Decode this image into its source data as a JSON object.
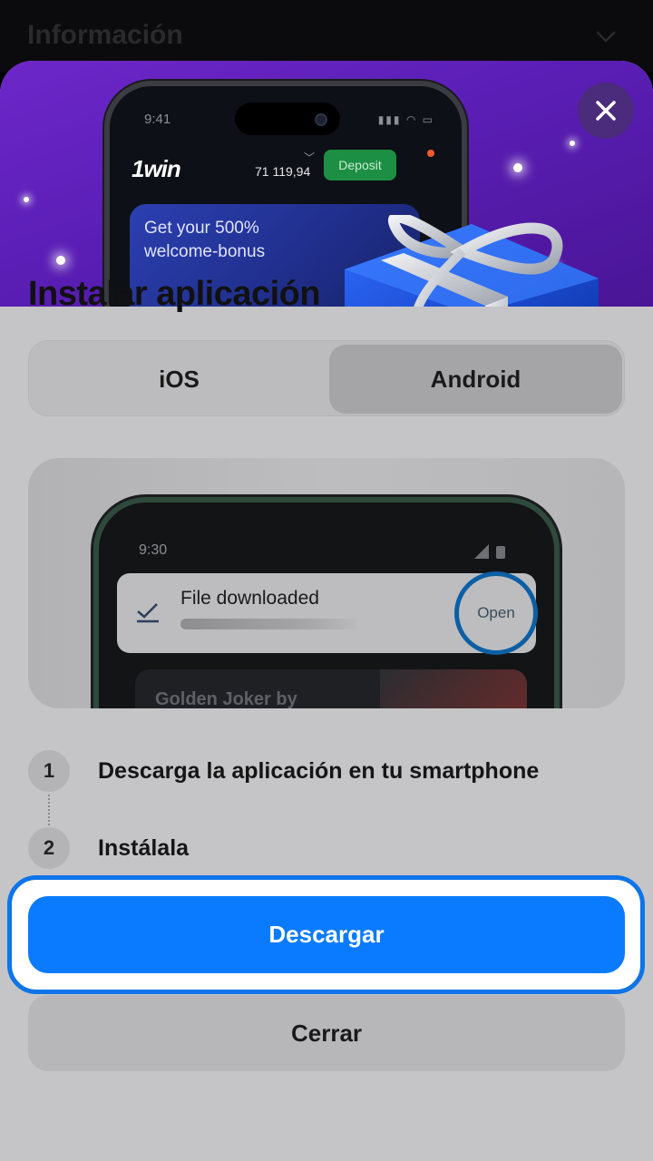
{
  "background_page": {
    "title": "Información"
  },
  "hero": {
    "phone_time": "9:41",
    "brand_logo": "1win",
    "balance": "71 119,94",
    "deposit_label": "Deposit",
    "banner_line1": "Get your 500%",
    "banner_line2": "welcome-bonus"
  },
  "modal": {
    "title": "Instalar aplicación",
    "tabs": [
      {
        "label": "iOS",
        "selected": false
      },
      {
        "label": "Android",
        "selected": true
      }
    ],
    "preview": {
      "phone_time": "9:30",
      "notification_title": "File downloaded",
      "notification_action": "Open",
      "game_title": "Golden Joker by"
    },
    "steps": [
      {
        "number": "1",
        "text": "Descarga la aplicación en tu smartphone"
      },
      {
        "number": "2",
        "text": "Instálala"
      }
    ],
    "download_button": "Descargar",
    "close_button": "Cerrar"
  },
  "colors": {
    "accent_blue": "#0a7bff",
    "hero_purple": "#6d27c9",
    "deposit_green": "#1d8f44"
  },
  "icons": [
    "close-icon",
    "chevron-down-icon",
    "checkmark-icon",
    "gift-icon"
  ]
}
